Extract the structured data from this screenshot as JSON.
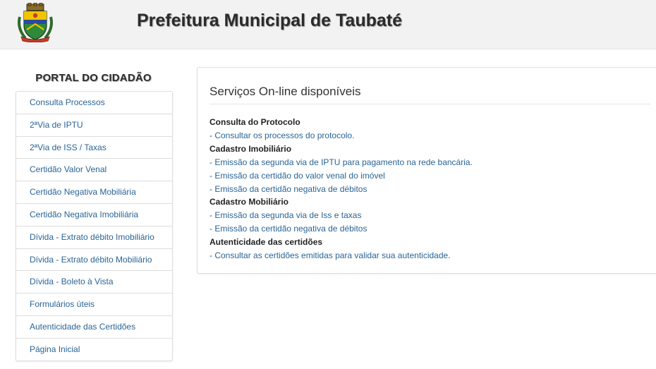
{
  "header": {
    "title": "Prefeitura Municipal de Taubaté"
  },
  "sidebar": {
    "heading": "PORTAL DO CIDADÃO",
    "items": [
      "Consulta Processos",
      "2ªVia de IPTU",
      "2ªVia de ISS / Taxas",
      "Certidão Valor Venal",
      "Certidão Negativa Mobiliária",
      "Certidão Negativa Imobiliária",
      "Dívida - Extrato débito Imobiliário",
      "Dívida - Extrato débito Mobiliário",
      "Dívida - Boleto à Vista",
      "Formulários úteis",
      "Autenticidade das Certidões",
      "Página Inicial"
    ]
  },
  "panel": {
    "title": "Serviços On-line disponíveis",
    "sections": [
      {
        "heading": "Consulta do Protocolo",
        "links": [
          "- Consultar os processos do protocolo."
        ]
      },
      {
        "heading": "Cadastro Imobiliário",
        "links": [
          "- Emissão da segunda via de IPTU para pagamento na rede bancária.",
          "- Emissão da certidão do valor venal do imóvel",
          "- Emissão da certidão negativa de débitos"
        ]
      },
      {
        "heading": "Cadastro Mobiliário",
        "links": [
          "- Emissão da segunda via de Iss e taxas",
          "- Emissão da certidão negativa de débitos"
        ]
      },
      {
        "heading": "Autenticidade das certidões",
        "links": [
          "- Consultar as certidões emitidas para validar sua autenticidade."
        ]
      }
    ]
  },
  "colors": {
    "link": "#2a6496",
    "header_bg": "#f2f2f2",
    "border": "#dddddd"
  },
  "icons": {
    "crest": "municipal-coat-of-arms-icon"
  }
}
